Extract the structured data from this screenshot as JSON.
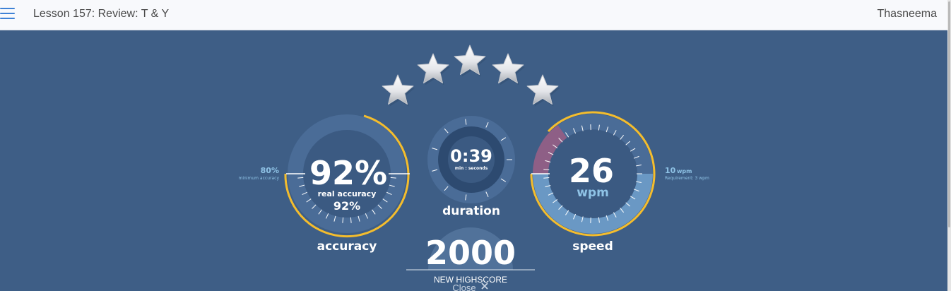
{
  "header": {
    "lesson_title": "Lesson 157: Review: T & Y",
    "user_name": "Thasneema",
    "menu_icon": "hamburger-menu-icon"
  },
  "rating": {
    "stars": 5,
    "max_stars": 5,
    "icon": "star-icon"
  },
  "accuracy": {
    "value": "92%",
    "real_label": "real accuracy",
    "real_value": "92%",
    "minimum_value": "80%",
    "minimum_label": "minimum accuracy",
    "title": "accuracy"
  },
  "duration": {
    "value": "0:39",
    "unit_label": "min : seconds",
    "title": "duration"
  },
  "speed": {
    "value": "26",
    "unit": "wpm",
    "requirement_value": "10",
    "requirement_unit": "wpm",
    "requirement_label": "Requirement: 3 wpm",
    "title": "speed"
  },
  "score": {
    "value": "2000",
    "label": "NEW HIGHSCORE"
  },
  "close": {
    "label": "Close",
    "icon": "close-icon"
  },
  "colors": {
    "background": "#3e5e86",
    "gauge_ring": "#f4bd2d",
    "gauge_inner": "#3b5a82",
    "speed_fill": "#6a98c4",
    "speed_low_zone": "#8e5f86",
    "accent_text": "#8fc3e6"
  }
}
